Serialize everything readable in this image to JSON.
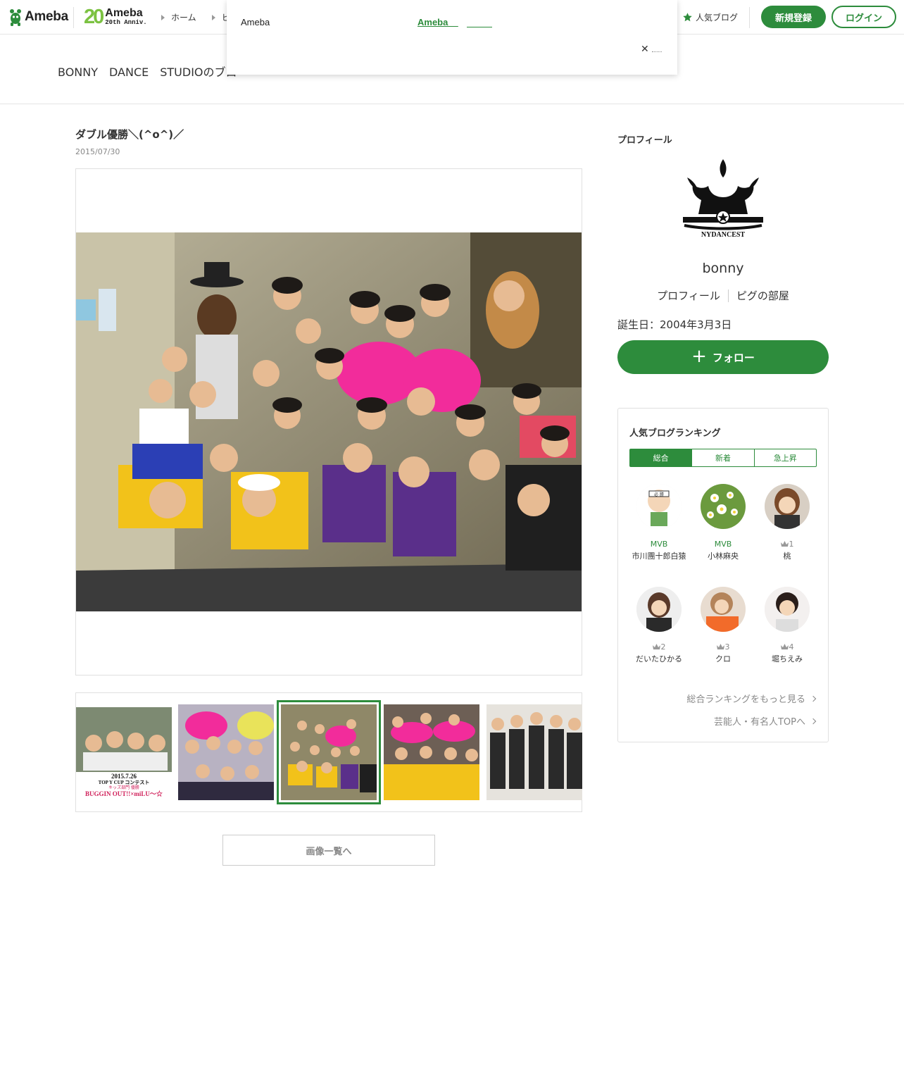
{
  "header": {
    "logo_text": "Ameba",
    "anniv_number": "20",
    "anniv_title": "Ameba",
    "anniv_sub": "20th Anniv.",
    "nav_home": "ホーム",
    "nav_pig": "ピ",
    "popular_blog": "人気ブログ",
    "register_label": "新規登録",
    "login_label": "ログイン",
    "accent_color": "#2d8c3c"
  },
  "blog": {
    "title": "BONNY　DANCE　STUDIOのブロ"
  },
  "popup": {
    "brand": "Ameba",
    "link_text": "Ameba    ",
    "close_label": "✕"
  },
  "article": {
    "title": "ダブル優勝＼(^o^)／",
    "date": "2015/07/30",
    "thumb_caption_date": "2015.7.26",
    "thumb_caption_event": "TOP Y CUP コンテスト",
    "thumb_caption_div": "キッズ部門  優勝",
    "thumb_caption_team": "BUGGIN OUT!!×miLU～☆",
    "image_list_button": "画像一覧へ"
  },
  "profile": {
    "heading": "プロフィール",
    "avatar_text": "NYDANCEST",
    "name": "bonny",
    "link_profile": "プロフィール",
    "link_pig_room": "ピグの部屋",
    "birthday": "誕生日：2004年3月3日",
    "follow_label": "フォロー"
  },
  "ranking": {
    "title": "人気ブログランキング",
    "tabs": [
      "総合",
      "新着",
      "急上昇"
    ],
    "items": [
      {
        "badge": "MVB",
        "name": "市川團十郎白猿"
      },
      {
        "badge": "MVB",
        "name": "小林麻央"
      },
      {
        "badge": "1",
        "name": "桃"
      },
      {
        "badge": "2",
        "name": "だいたひかる"
      },
      {
        "badge": "3",
        "name": "クロ"
      },
      {
        "badge": "4",
        "name": "堀ちえみ"
      }
    ],
    "more_overall": "総合ランキングをもっと見る",
    "more_celebrity": "芸能人・有名人TOPへ"
  }
}
